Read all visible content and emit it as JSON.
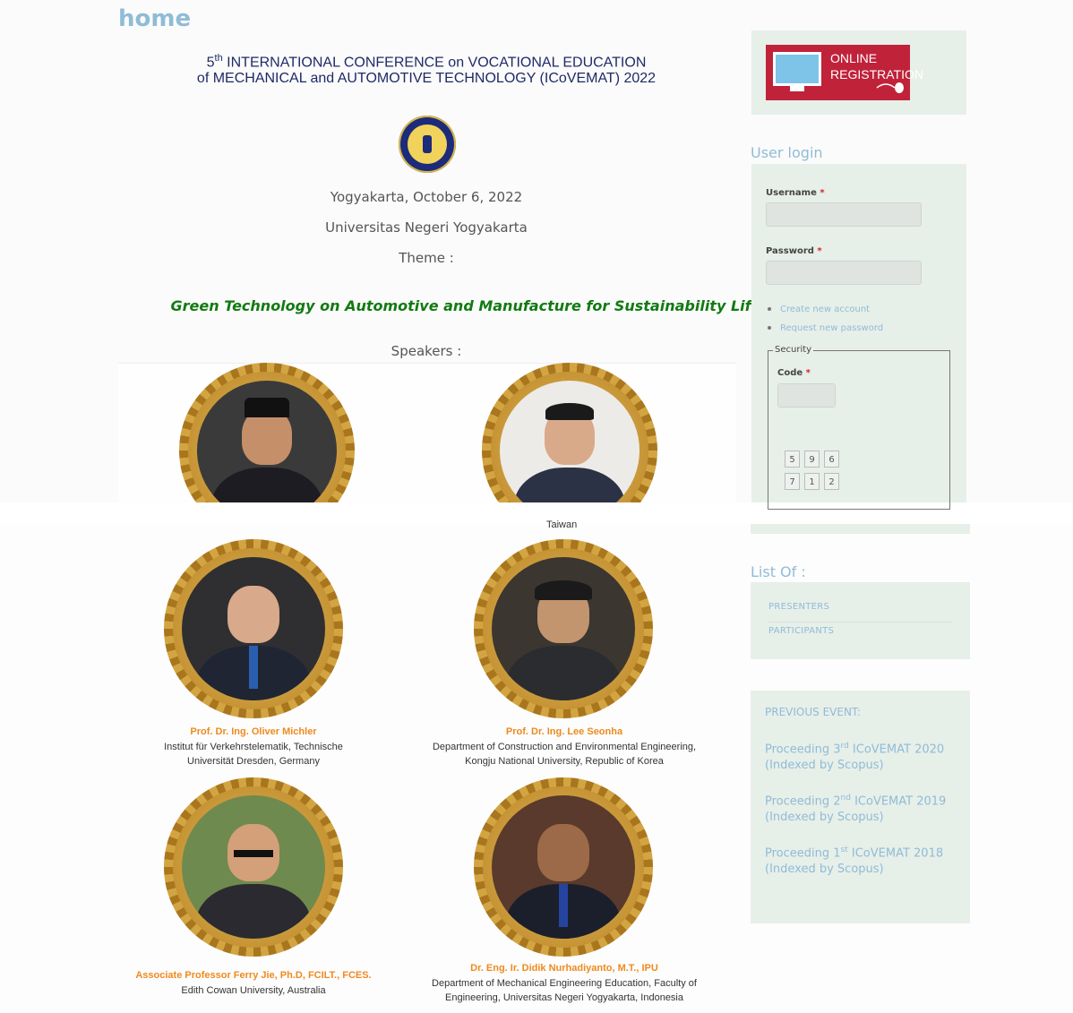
{
  "page": {
    "title": "home"
  },
  "conference": {
    "title_number": "5",
    "title_suffix": "th",
    "title_line1_rest": " INTERNATIONAL CONFERENCE on VOCATIONAL EDUCATION",
    "title_line2": "of MECHANICAL and AUTOMOTIVE TECHNOLOGY (ICoVEMAT) 2022",
    "location_date": "Yogyakarta, October 6, 2022",
    "venue": "Universitas Negeri Yogyakarta",
    "theme_label": "Theme :",
    "theme": "Green Technology on Automotive and Manufacture for Sustainability Life",
    "speakers_label": "Speakers :"
  },
  "speakers": [
    {
      "name": "",
      "affiliation": ""
    },
    {
      "name": "",
      "affiliation_tail": "Taiwan"
    },
    {
      "name": "Prof. Dr. Ing. Oliver Michler",
      "affiliation_line1": "Institut für Verkehrstelematik, Technische",
      "affiliation_line2": "Universität Dresden, Germany"
    },
    {
      "name": "Prof. Dr. Ing. Lee Seonha",
      "affiliation_line1": "Department of Construction and Environmental Engineering,",
      "affiliation_line2": "Kongju National University, Republic of Korea"
    },
    {
      "name": "Associate Professor Ferry Jie, Ph.D, FCILT., FCES.",
      "affiliation_line1": "Edith Cowan University, Australia"
    },
    {
      "name": "Dr. Eng. Ir. Didik Nurhadiyanto, M.T., IPU",
      "affiliation_line1": "Department of Mechanical Engineering Education, Faculty of",
      "affiliation_line2": "Engineering, Universitas Negeri Yogyakarta, Indonesia"
    }
  ],
  "sidebar": {
    "registration": {
      "line1": "ONLINE",
      "line2": "REGISTRATION"
    },
    "login": {
      "heading": "User login",
      "username_label": "Username",
      "password_label": "Password",
      "required_mark": "*",
      "create_account": "Create new account",
      "request_password": "Request new password",
      "security_legend": "Security",
      "code_label": "Code",
      "keypad": [
        "5",
        "9",
        "6",
        "7",
        "1",
        "2"
      ]
    },
    "list_of": {
      "heading": "List Of :",
      "items": [
        "PRESENTERS",
        "PARTICIPANTS"
      ]
    },
    "previous_event": {
      "heading": "PREVIOUS EVENT:",
      "items": [
        {
          "prefix": "Proceeding 3",
          "sup": "rd",
          "suffix": " ICoVEMAT 2020",
          "note": "(Indexed by Scopus)"
        },
        {
          "prefix": "Proceeding 2",
          "sup": "nd",
          "suffix": " ICoVEMAT 2019",
          "note": "(Indexed by Scopus)"
        },
        {
          "prefix": "Proceeding 1",
          "sup": "st",
          "suffix": " ICoVEMAT 2018",
          "note": "(Indexed by Scopus)"
        }
      ]
    }
  }
}
